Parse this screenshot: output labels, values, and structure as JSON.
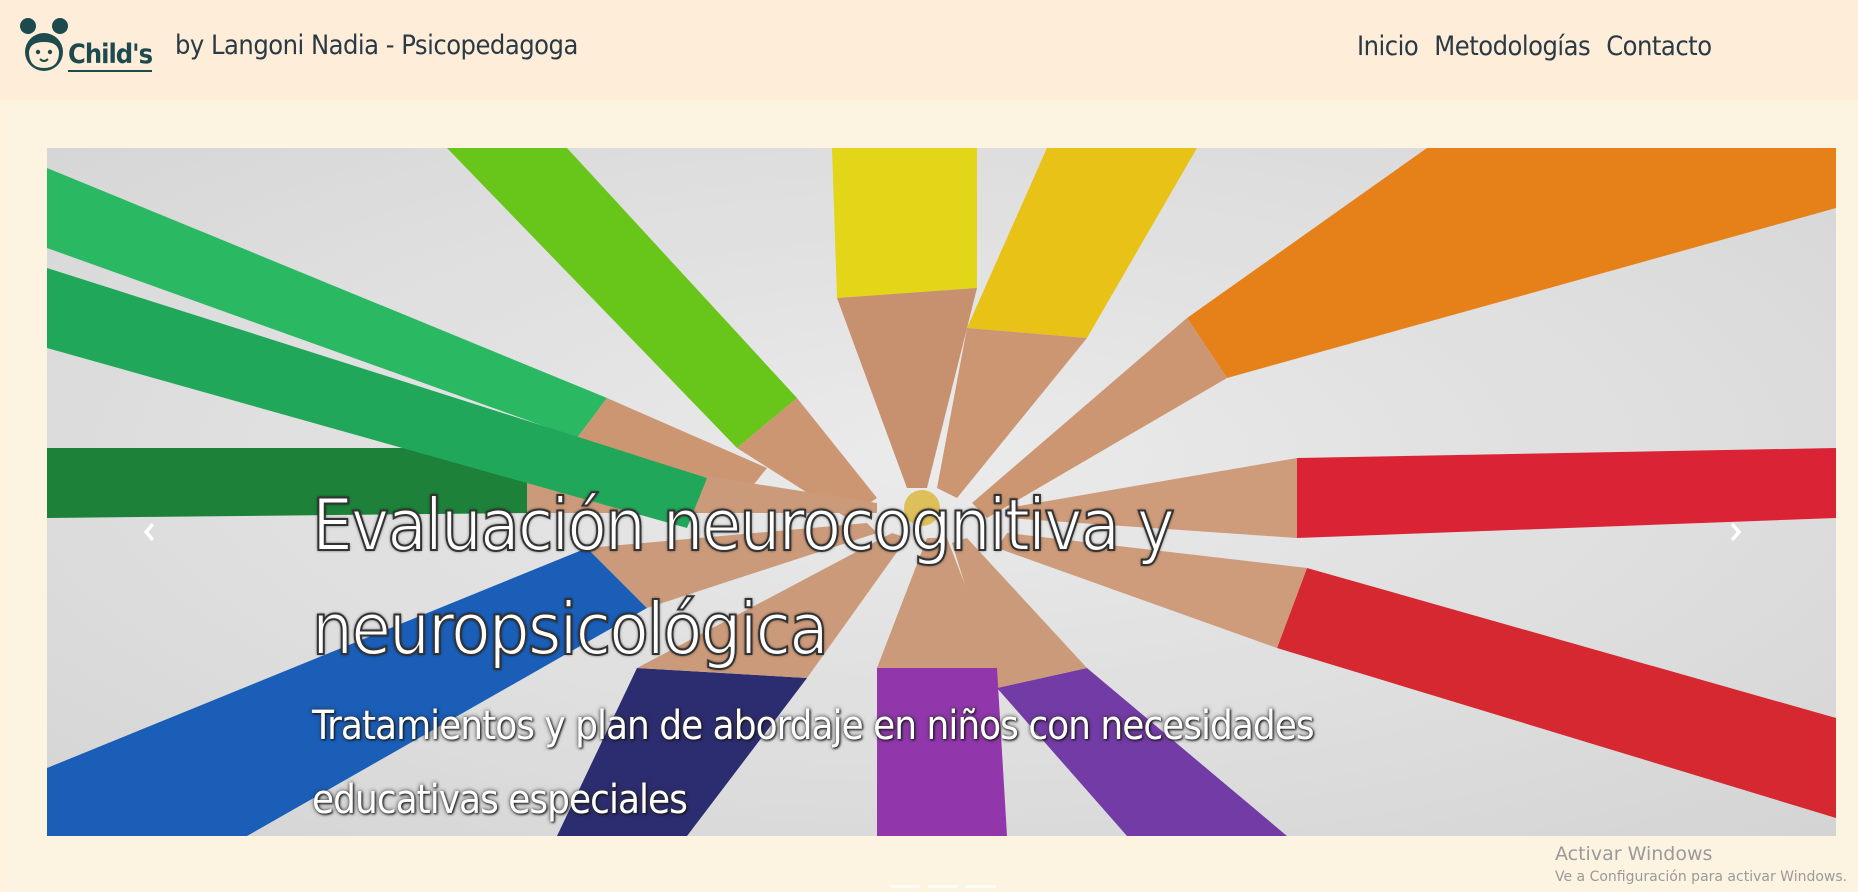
{
  "header": {
    "brand_name": "Child's",
    "byline": "by Langoni Nadia - Psicopedagoga",
    "logo_icon": "girl-face-icon"
  },
  "nav": {
    "items": [
      {
        "label": "Inicio"
      },
      {
        "label": "Metodologías"
      },
      {
        "label": "Contacto"
      }
    ]
  },
  "carousel": {
    "title": "Evaluación neurocognitiva y neuropsicológica",
    "subtitle": "Tratamientos y plan de abordaje en niños con necesidades educativas especiales",
    "prev_icon": "chevron-left-icon",
    "next_icon": "chevron-right-icon"
  },
  "watermark": {
    "line1": "Activar Windows",
    "line2": "Ve a Configuración para activar Windows."
  },
  "colors": {
    "header_bg": "#feedd8",
    "page_bg": "#fcf4e1",
    "text_dark": "#2a3a45",
    "brand_teal": "#1d4a4e"
  }
}
